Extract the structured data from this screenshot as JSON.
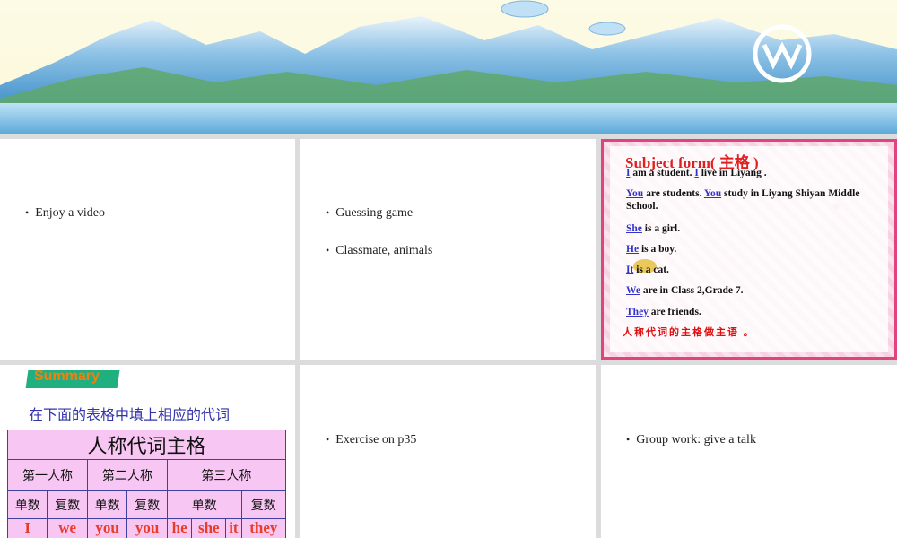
{
  "slides": {
    "slide1": {
      "bullet": "Enjoy a video"
    },
    "slide2": {
      "bullets": [
        "Guessing game",
        "Classmate, animals"
      ]
    },
    "slide3": {
      "title": "Subject form( 主格 )",
      "lines": [
        {
          "pronoun": "I",
          "rest": " am a student. ",
          "pronoun2": "I",
          "rest2": " live in Liyang ."
        },
        {
          "pronoun": "You",
          "rest": " are students. ",
          "pronoun2": "You",
          "rest2": " study in Liyang Shiyan Middle School."
        },
        {
          "pronoun": "She",
          "rest": " is a girl."
        },
        {
          "pronoun": "He",
          "rest": " is a boy."
        },
        {
          "pronoun": "It",
          "rest": " is a cat."
        },
        {
          "pronoun": "We",
          "rest": " are in Class 2,Grade 7."
        },
        {
          "pronoun": "They",
          "rest": "  are  friends."
        }
      ],
      "note": "人称代词的主格做主语 。"
    },
    "slide4": {
      "badge": "Summary",
      "instruction": "在下面的表格中填上相应的代词",
      "table": {
        "title": "人称代词主格",
        "groups": [
          "第一人称",
          "第二人称",
          "第三人称"
        ],
        "subheaders": [
          "单数",
          "复数",
          "单数",
          "复数",
          "单数",
          "复数"
        ],
        "values": [
          "I",
          "we",
          "you",
          "you",
          "he",
          "she",
          "it",
          "they"
        ]
      }
    },
    "slide5": {
      "bullet": "Exercise on p35"
    },
    "slide6": {
      "bullet": "Group work: give a talk"
    }
  },
  "colors": {
    "accent_red": "#e02020",
    "pronoun_blue": "#3333cc",
    "table_bg": "#f7c6f3",
    "frame_pink": "#e0447e"
  }
}
